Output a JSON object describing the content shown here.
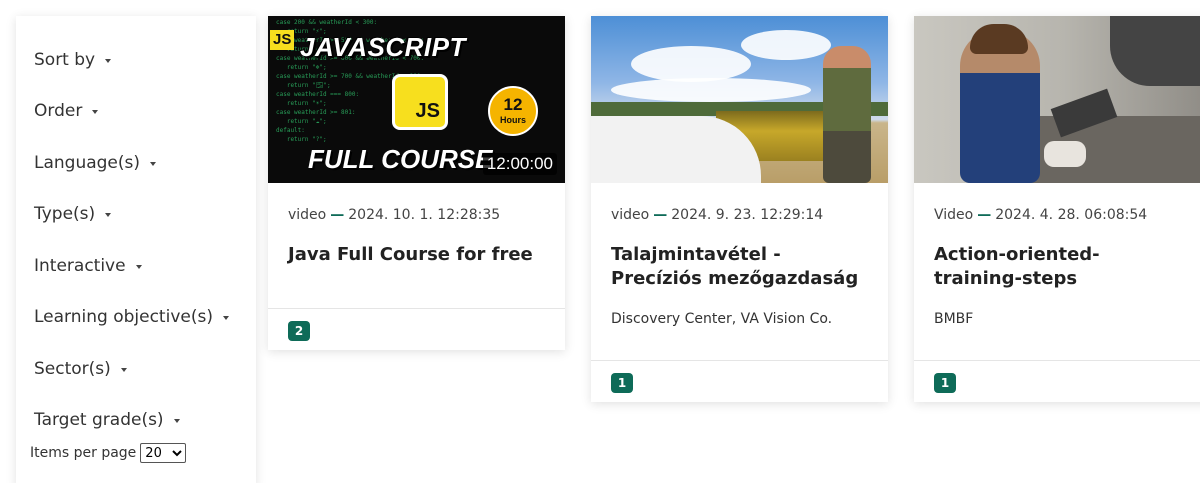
{
  "sidebar": {
    "filters": [
      {
        "label": "Sort by"
      },
      {
        "label": "Order"
      },
      {
        "label": "Language(s)"
      },
      {
        "label": "Type(s)"
      },
      {
        "label": "Interactive"
      },
      {
        "label": "Learning objective(s)"
      },
      {
        "label": "Sector(s)"
      },
      {
        "label": "Target grade(s)"
      }
    ],
    "items_per_page_label": "Items per page",
    "items_per_page_value": "20"
  },
  "cards": [
    {
      "type": "video",
      "date": "2024. 10. 1. 12:28:35",
      "title": "Java Full Course for free",
      "author": "",
      "badge": "2",
      "thumbnail": {
        "tag": "JS",
        "heading": "JAVASCRIPT",
        "logo": "JS",
        "hours_number": "12",
        "hours_label": "Hours",
        "subheading": "FULL COURSE",
        "duration": "12:00:00"
      }
    },
    {
      "type": "video",
      "date": "2024. 9. 23. 12:29:14",
      "title": "Talajmintavétel - Precíziós mezőgazdaság",
      "author": "Discovery Center, VA Vision Co.",
      "badge": "1"
    },
    {
      "type": "Video",
      "date": "2024. 4. 28. 06:08:54",
      "title": "Action-oriented-training-steps",
      "author": "BMBF",
      "badge": "1"
    }
  ],
  "colors": {
    "accent": "#0e6b58",
    "js_yellow": "#f7df1e"
  }
}
